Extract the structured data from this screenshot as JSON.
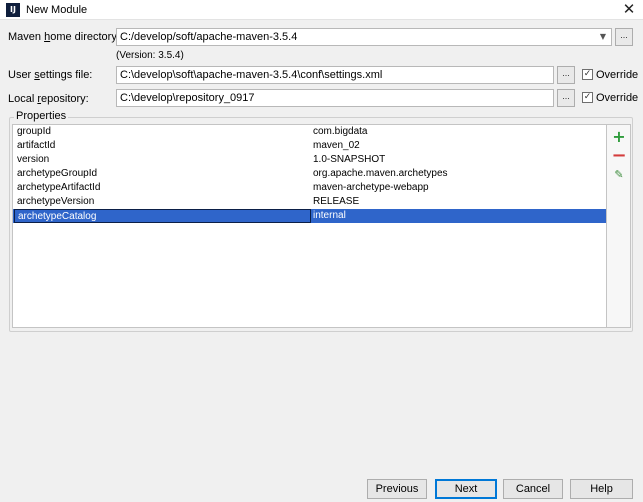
{
  "window": {
    "app_icon_text": "IJ",
    "title": "New Module",
    "close_symbol": "✕"
  },
  "maven_home": {
    "label_pre": "Maven ",
    "label_mnemonic": "h",
    "label_post": "ome directory:",
    "value": "C:/develop/soft/apache-maven-3.5.4",
    "version_note": "(Version: 3.5.4)"
  },
  "user_settings": {
    "label_pre": "User ",
    "label_mnemonic": "s",
    "label_post": "ettings file:",
    "value": "C:\\develop\\soft\\apache-maven-3.5.4\\conf\\settings.xml",
    "override_label": "Override",
    "override_checked": true
  },
  "local_repository": {
    "label_pre": "Local ",
    "label_mnemonic": "r",
    "label_post": "epository:",
    "value": "C:\\develop\\repository_0917",
    "override_label": "Override",
    "override_checked": true
  },
  "browse_label": "...",
  "checkmark": "✓",
  "dropdown_arrow": "▼",
  "properties": {
    "title": "Properties",
    "rows": [
      {
        "key": "groupId",
        "value": "com.bigdata"
      },
      {
        "key": "artifactId",
        "value": "maven_02"
      },
      {
        "key": "version",
        "value": "1.0-SNAPSHOT"
      },
      {
        "key": "archetypeGroupId",
        "value": "org.apache.maven.archetypes"
      },
      {
        "key": "archetypeArtifactId",
        "value": "maven-archetype-webapp"
      },
      {
        "key": "archetypeVersion",
        "value": "RELEASE"
      },
      {
        "key": "archetypeCatalog",
        "value": "internal"
      }
    ],
    "selected_index": 6,
    "toolbar": {
      "add": "+",
      "remove": "−",
      "edit": "✎"
    }
  },
  "buttons": {
    "previous": "Previous",
    "next": "Next",
    "cancel": "Cancel",
    "help": "Help"
  },
  "colors": {
    "selection": "#2f65ca",
    "add_icon": "#2f9c3c",
    "remove_icon": "#d43c3c",
    "default_button_border": "#0078d7"
  }
}
